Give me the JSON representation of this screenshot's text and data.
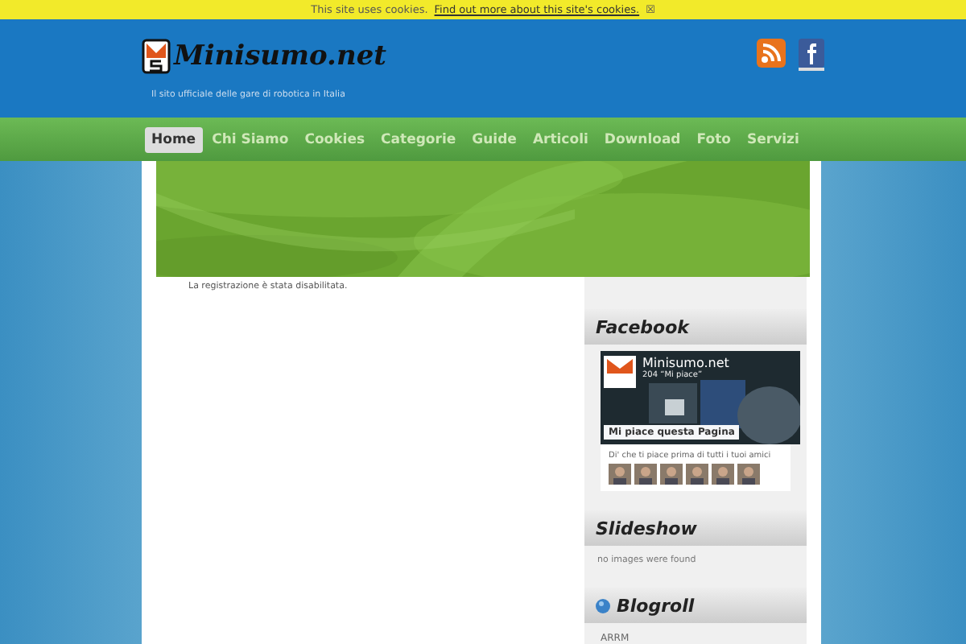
{
  "cookie_bar": {
    "text": "This site uses cookies.",
    "link": "Find out more about this site's cookies.",
    "close": "☒"
  },
  "header": {
    "logo": "Minisumo.net",
    "tagline": "Il sito ufficiale delle gare di robotica in Italia"
  },
  "nav": [
    {
      "label": "Home",
      "selected": true
    },
    {
      "label": "Chi Siamo",
      "selected": false
    },
    {
      "label": "Cookies",
      "selected": false
    },
    {
      "label": "Categorie",
      "selected": false
    },
    {
      "label": "Guide",
      "selected": false
    },
    {
      "label": "Articoli",
      "selected": false
    },
    {
      "label": "Download",
      "selected": false
    },
    {
      "label": "Foto",
      "selected": false
    },
    {
      "label": "Servizi",
      "selected": false
    }
  ],
  "main": {
    "message": "La registrazione è stata disabilitata."
  },
  "sidebar": [
    {
      "kind": "facebook",
      "title": "Facebook",
      "page_name": "Minisumo.net",
      "likes": "204 “Mi piace”",
      "like_button": "Mi piace questa Pagina",
      "friends_text": "Di' che ti piace prima di tutti i tuoi amici"
    },
    {
      "kind": "text",
      "title": "Slideshow",
      "text": "no images were found"
    },
    {
      "kind": "links",
      "title": "Blogroll",
      "links": [
        "ARRM"
      ]
    }
  ]
}
